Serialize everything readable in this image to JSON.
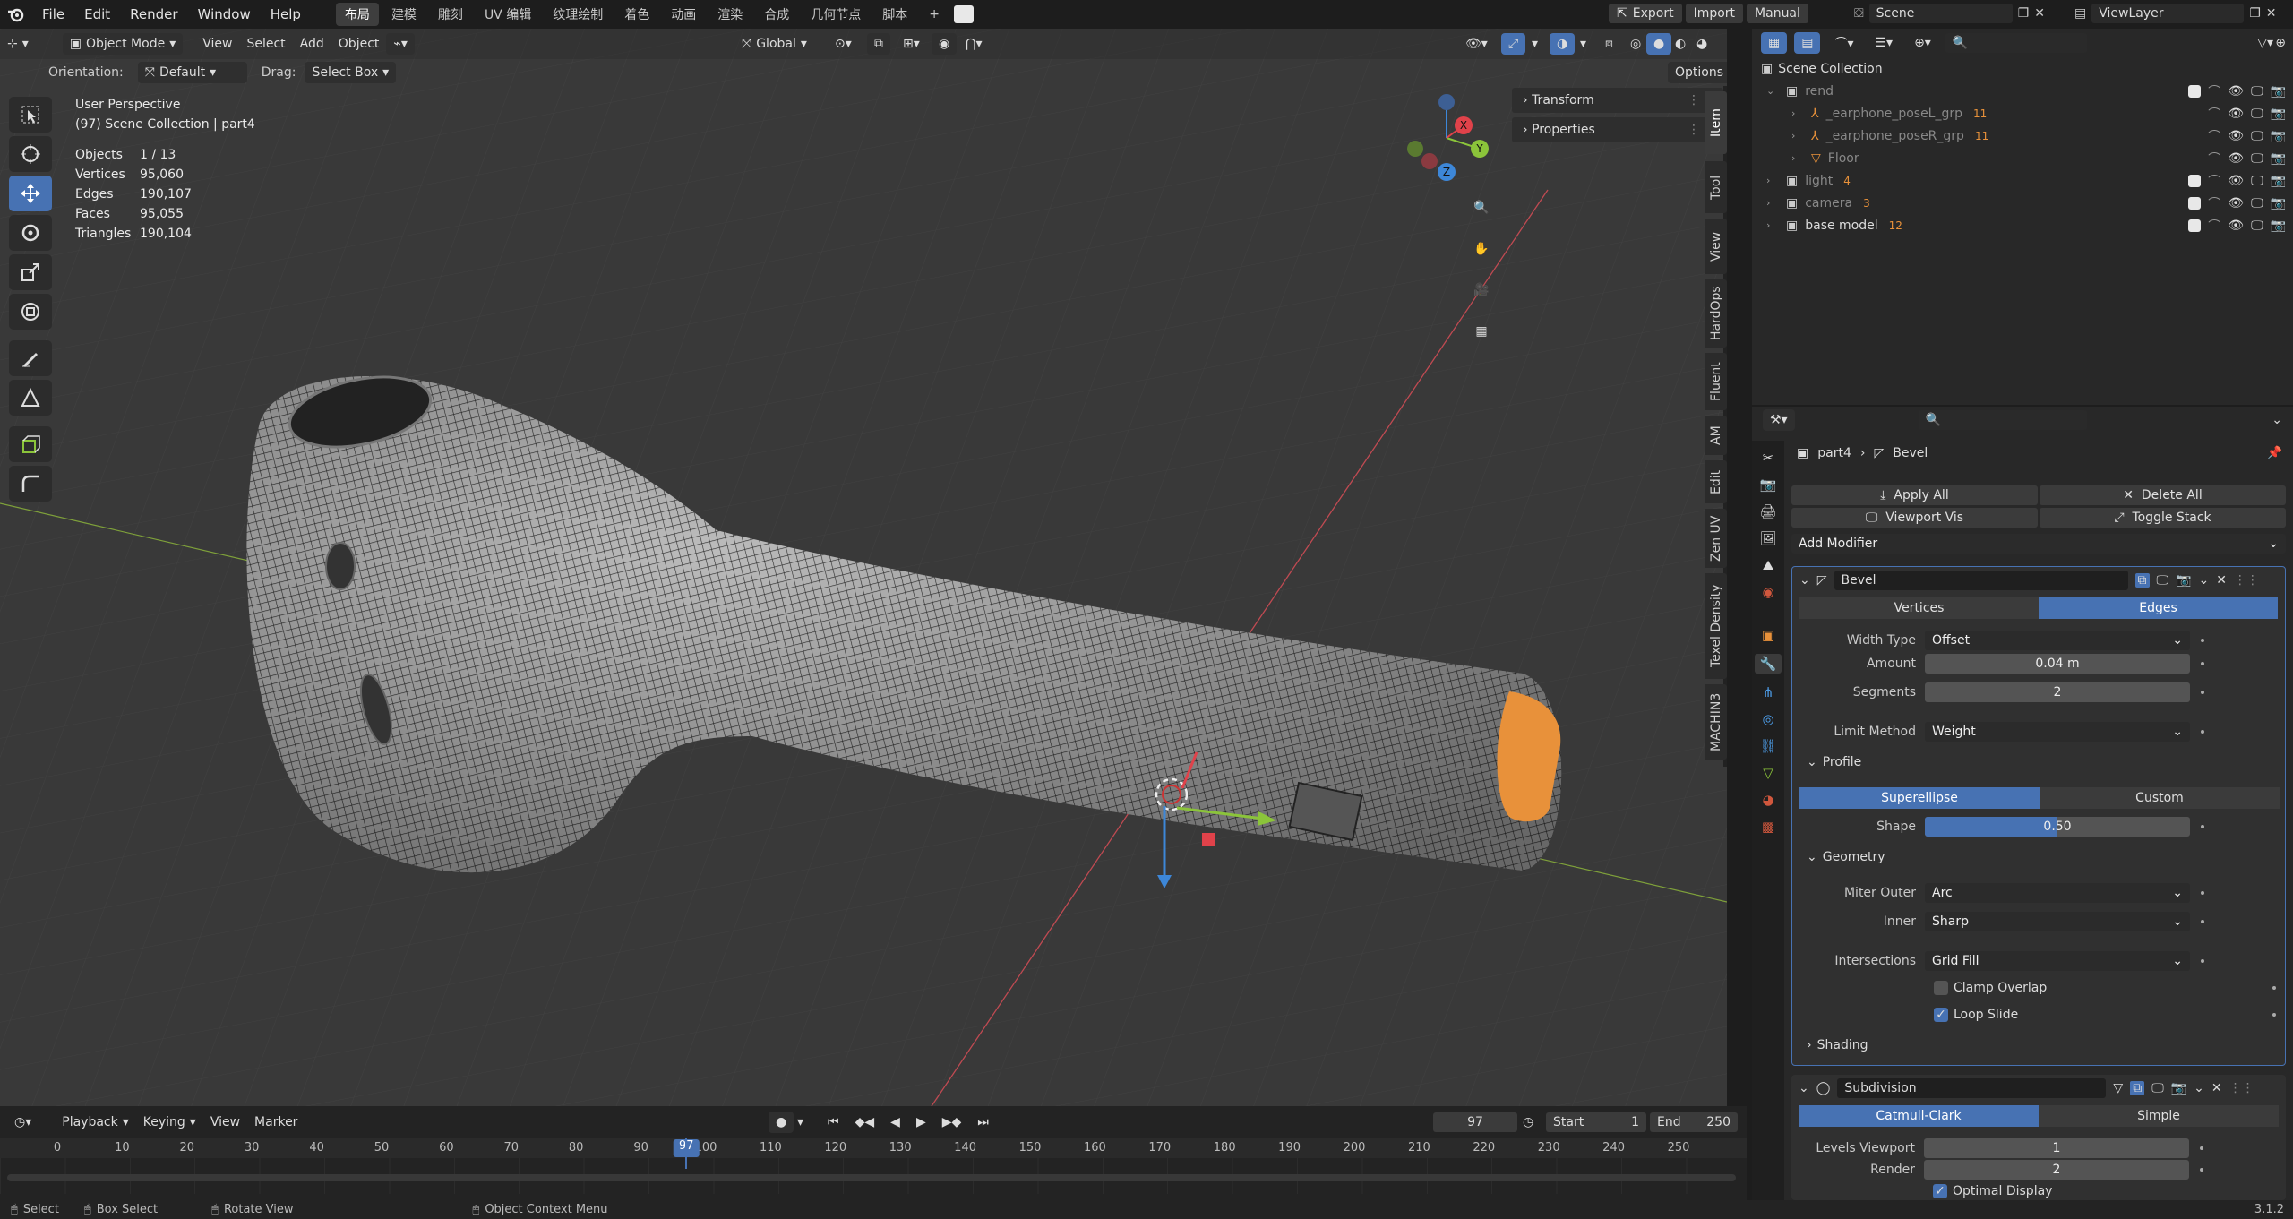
{
  "topbar": {
    "menus": [
      "File",
      "Edit",
      "Render",
      "Window",
      "Help"
    ],
    "workspaces": [
      "布局",
      "建模",
      "雕刻",
      "UV 编辑",
      "纹理绘制",
      "着色",
      "动画",
      "渲染",
      "合成",
      "几何节点",
      "脚本"
    ],
    "active_workspace": "布局",
    "export_label": "Export",
    "import_label": "Import",
    "manual_label": "Manual",
    "scene_label": "Scene",
    "viewlayer_label": "ViewLayer"
  },
  "viewport": {
    "mode": "Object Mode",
    "menus": [
      "View",
      "Select",
      "Add",
      "Object"
    ],
    "transform_space": "Global",
    "orientation_label": "Orientation:",
    "orientation_value": "Default",
    "drag_label": "Drag:",
    "drag_value": "Select Box",
    "options_label": "Options",
    "perspective": "User Perspective",
    "collection": "(97) Scene Collection | part4",
    "stats": [
      {
        "label": "Objects",
        "value": "1 / 13"
      },
      {
        "label": "Vertices",
        "value": "95,060"
      },
      {
        "label": "Edges",
        "value": "190,107"
      },
      {
        "label": "Faces",
        "value": "95,055"
      },
      {
        "label": "Triangles",
        "value": "190,104"
      }
    ],
    "npanels": [
      "Transform",
      "Properties"
    ],
    "side_tabs": [
      "Item",
      "Tool",
      "View",
      "HardOps",
      "Fluent",
      "AM",
      "Edit",
      "Zen UV",
      "Texel Density",
      "MACHIN3"
    ],
    "gizmo_axes": {
      "x": "X",
      "y": "Y",
      "z": "Z"
    },
    "colors": {
      "x_axis": "#e0424a",
      "y_axis": "#8bc43a",
      "z_axis": "#3d87d8",
      "accent": "#4772b3",
      "highlight": "#e8913a"
    }
  },
  "timeline": {
    "menus": [
      "Playback",
      "Keying",
      "View",
      "Marker"
    ],
    "current_frame": "97",
    "start_label": "Start",
    "start_value": "1",
    "end_label": "End",
    "end_value": "250",
    "ticks": [
      "0",
      "10",
      "20",
      "30",
      "40",
      "50",
      "60",
      "70",
      "80",
      "90",
      "100",
      "110",
      "120",
      "130",
      "140",
      "150",
      "160",
      "170",
      "180",
      "190",
      "200",
      "210",
      "220",
      "230",
      "240",
      "250"
    ]
  },
  "status": {
    "items": [
      "Select",
      "Box Select",
      "Rotate View",
      "Object Context Menu"
    ],
    "version": "3.1.2"
  },
  "outliner": {
    "root": "Scene Collection",
    "rows": [
      {
        "label": "rend",
        "indent": 0,
        "type": "collection",
        "badge": ""
      },
      {
        "label": "_earphone_poseL_grp",
        "indent": 1,
        "type": "armature",
        "badge": "11"
      },
      {
        "label": "_earphone_poseR_grp",
        "indent": 1,
        "type": "armature",
        "badge": "11"
      },
      {
        "label": "Floor",
        "indent": 1,
        "type": "mesh",
        "badge": ""
      },
      {
        "label": "light",
        "indent": 0,
        "type": "collection",
        "badge": "4"
      },
      {
        "label": "camera",
        "indent": 0,
        "type": "collection",
        "badge": "3"
      },
      {
        "label": "base model",
        "indent": 0,
        "type": "collection",
        "badge": "12"
      }
    ]
  },
  "properties": {
    "breadcrumb_object": "part4",
    "breadcrumb_modifier": "Bevel",
    "apply_all": "Apply All",
    "delete_all": "Delete All",
    "viewport_vis": "Viewport Vis",
    "toggle_stack": "Toggle Stack",
    "add_modifier": "Add Modifier",
    "bevel": {
      "name": "Bevel",
      "affect_options": [
        "Vertices",
        "Edges"
      ],
      "affect_selected": "Edges",
      "width_type_label": "Width Type",
      "width_type": "Offset",
      "amount_label": "Amount",
      "amount": "0.04 m",
      "segments_label": "Segments",
      "segments": "2",
      "limit_label": "Limit Method",
      "limit_method": "Weight",
      "profile_label": "Profile",
      "profile_options": [
        "Superellipse",
        "Custom"
      ],
      "profile_selected": "Superellipse",
      "shape_label": "Shape",
      "shape": "0.50",
      "shape_fraction": 0.5,
      "geometry_label": "Geometry",
      "miter_outer_label": "Miter Outer",
      "miter_outer": "Arc",
      "inner_label": "Inner",
      "inner": "Sharp",
      "intersections_label": "Intersections",
      "intersections": "Grid Fill",
      "clamp_overlap": "Clamp Overlap",
      "clamp_checked": false,
      "loop_slide": "Loop Slide",
      "loop_checked": true,
      "shading_label": "Shading"
    },
    "subdivision": {
      "name": "Subdivision",
      "options": [
        "Catmull-Clark",
        "Simple"
      ],
      "selected": "Catmull-Clark",
      "levels_viewport_label": "Levels Viewport",
      "levels_viewport": "1",
      "render_label": "Render",
      "render": "2",
      "optimal_display": "Optimal Display"
    }
  }
}
